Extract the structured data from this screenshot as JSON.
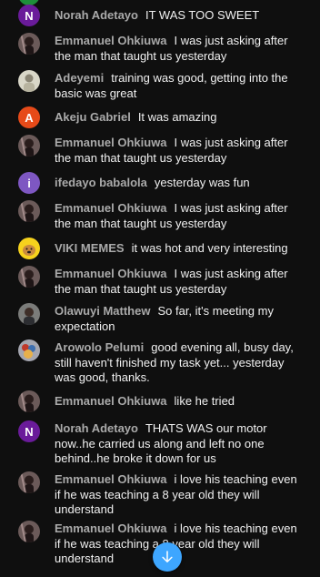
{
  "messages": [
    {
      "author": "Norah Adetayo",
      "text": "IT WAS TOO SWEET",
      "avatar": {
        "type": "letter",
        "letter": "N",
        "color": "#6a1b9a"
      }
    },
    {
      "author": "Emmanuel Ohkiuwa",
      "text": "I was just asking after the man that taught us yesterday",
      "avatar": {
        "type": "photo",
        "kind": "portrait-dark"
      }
    },
    {
      "author": "Adeyemi",
      "text": "training was good, getting into the basic was great",
      "avatar": {
        "type": "photo",
        "kind": "portrait-light"
      }
    },
    {
      "author": "Akeju Gabriel",
      "text": "It was amazing",
      "avatar": {
        "type": "letter",
        "letter": "A",
        "color": "#e64a19"
      }
    },
    {
      "author": "Emmanuel Ohkiuwa",
      "text": "I was just asking after the man that taught us yesterday",
      "avatar": {
        "type": "photo",
        "kind": "portrait-dark"
      }
    },
    {
      "author": "ifedayo babalola",
      "text": "yesterday was fun",
      "avatar": {
        "type": "letter",
        "letter": "i",
        "color": "#7e57c2"
      }
    },
    {
      "author": "Emmanuel Ohkiuwa",
      "text": "I was just asking after the man that taught us yesterday",
      "avatar": {
        "type": "photo",
        "kind": "portrait-dark"
      }
    },
    {
      "author": "VIKI MEMES",
      "text": "it was hot and very interesting",
      "avatar": {
        "type": "photo",
        "kind": "doge"
      }
    },
    {
      "author": "Emmanuel Ohkiuwa",
      "text": "I was just asking after the man that taught us yesterday",
      "avatar": {
        "type": "photo",
        "kind": "portrait-dark"
      }
    },
    {
      "author": "Olawuyi Matthew",
      "text": "So far, it's meeting my expectation",
      "avatar": {
        "type": "photo",
        "kind": "portrait-gray"
      }
    },
    {
      "author": "Arowolo Pelumi",
      "text": "good evening all, busy day, still haven't finished my task yet... yesterday was good, thanks.",
      "avatar": {
        "type": "photo",
        "kind": "colorful"
      }
    },
    {
      "author": "Emmanuel Ohkiuwa",
      "text": "like he tried",
      "avatar": {
        "type": "photo",
        "kind": "portrait-dark"
      }
    },
    {
      "author": "Norah Adetayo",
      "text": "THATS WAS our motor now..he carried us along and left no one behind..he broke it down for us",
      "avatar": {
        "type": "letter",
        "letter": "N",
        "color": "#6a1b9a"
      }
    },
    {
      "author": "Emmanuel Ohkiuwa",
      "text": "i love his teaching even if he was teaching a 8 year old they will understand",
      "avatar": {
        "type": "photo",
        "kind": "portrait-dark"
      }
    },
    {
      "author": "Emmanuel Ohkiuwa",
      "text": "i love his teaching even if he was teaching a 8 year old they will understand",
      "avatar": {
        "type": "photo",
        "kind": "portrait-dark"
      }
    }
  ],
  "colors": {
    "background": "#0f0f0f",
    "author": "#aaaaaa",
    "message": "#f1f1f1",
    "scroll_button": "#3ea6ff"
  },
  "scroll_button": {
    "icon": "arrow-down-icon"
  }
}
